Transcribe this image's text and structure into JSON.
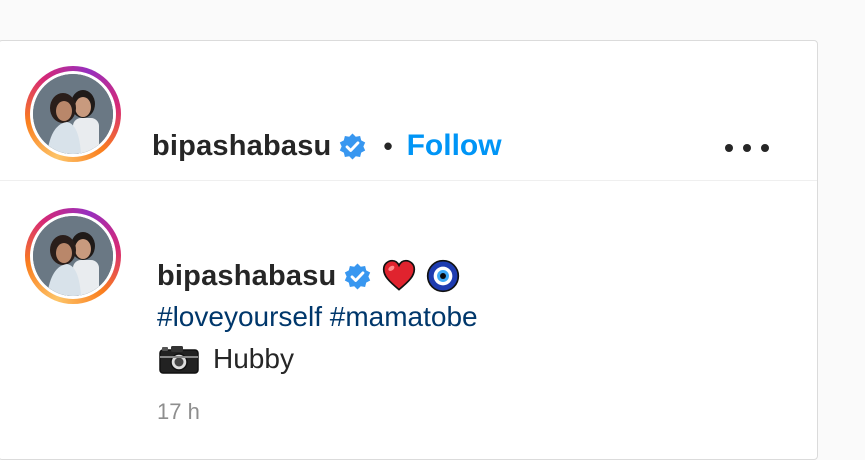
{
  "header": {
    "username": "bipashabasu",
    "separator": "•",
    "follow_label": "Follow",
    "verified_icon": "verified-badge-icon",
    "more_icon": "more-options-icon"
  },
  "caption": {
    "username": "bipashabasu",
    "emojis": [
      "red-heart-icon",
      "nazar-amulet-icon"
    ],
    "hashtags": [
      "#loveyourself",
      "#mamatobe"
    ],
    "text": "Hubby",
    "text_icon": "camera-icon",
    "timestamp": "17 h"
  },
  "colors": {
    "follow": "#0095f6",
    "hashtag": "#00376b",
    "verified": "#3897f0",
    "muted": "#8e8e8e"
  }
}
